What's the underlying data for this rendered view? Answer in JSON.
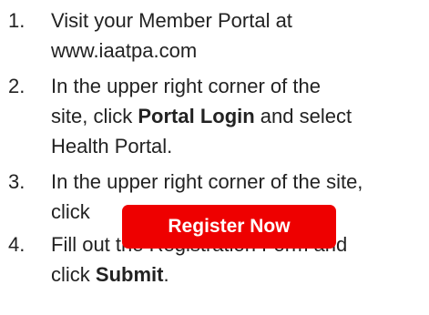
{
  "steps": [
    {
      "number": "1.",
      "line1": "Visit your Member Portal at",
      "line2": "www.iaatpa.com"
    },
    {
      "number": "2.",
      "line1": "In the upper right corner of the",
      "line2_prefix": "site, click ",
      "line2_bold": "Portal Login",
      "line2_suffix": " and select",
      "line3": "Health Portal."
    },
    {
      "number": "3.",
      "line1": "In the upper right corner of the site,",
      "line2": "click",
      "button_label": "Register Now",
      "button_color": "#ee0000"
    },
    {
      "number": "4.",
      "line1": "Fill out the Registration Form and",
      "line2_prefix": "click ",
      "line2_bold": "Submit",
      "line2_suffix": "."
    }
  ]
}
